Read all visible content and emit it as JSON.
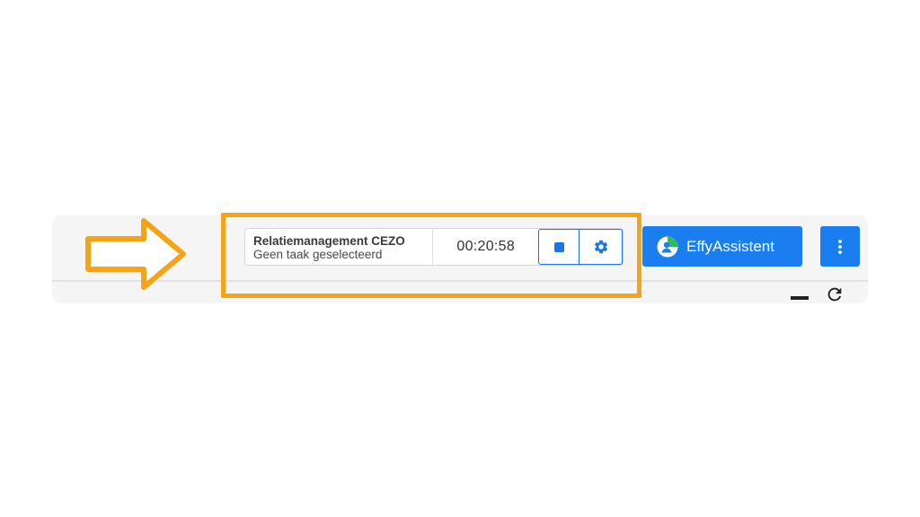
{
  "task_widget": {
    "title": "Relatiemanagement CEZO",
    "subtitle": "Geen taak geselecteerd",
    "timer": "00:20:58",
    "stop_icon": "stop-icon",
    "settings_icon": "gear-icon"
  },
  "assistant": {
    "label": "EffyAssistent",
    "logo_icon": "effy-logo-icon"
  },
  "toolbar": {
    "more_icon": "vertical-ellipsis-icon",
    "minimize_icon": "minimize-icon",
    "refresh_icon": "refresh-icon"
  },
  "annotation": {
    "arrow_icon": "arrow-right-icon",
    "highlight_color": "#f7a318"
  },
  "colors": {
    "primary": "#1a7df0",
    "toolbar_bg": "#f5f5f6",
    "accent_green": "#2ebd59"
  }
}
